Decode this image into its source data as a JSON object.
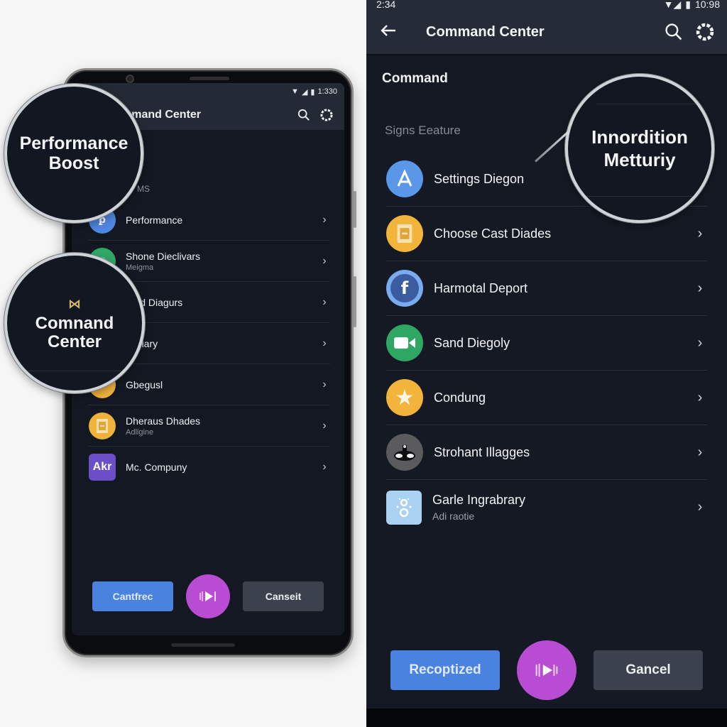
{
  "left_phone": {
    "status_bar": {
      "time": "1:330"
    },
    "app_bar": {
      "title": "mmand Center",
      "search_icon": "search-icon",
      "settings_icon": "gear-icon"
    },
    "section_label": "MS",
    "items": [
      {
        "title": "Performance",
        "subtitle": "",
        "icon": "performance-icon",
        "color": "#4f86e0"
      },
      {
        "title": "Shone Dieclivars",
        "subtitle": "Meigma",
        "icon": "gear-icon",
        "color": "#2fa866"
      },
      {
        "title": "rand Diagurs",
        "subtitle": "",
        "icon": "generic-icon",
        "color": "#3b4250"
      },
      {
        "title": "ntullary",
        "subtitle": "",
        "icon": "generic-icon",
        "color": "#3b4250"
      },
      {
        "title": "Gbegusl",
        "subtitle": "",
        "icon": "generic-icon",
        "color": "#f0b23b"
      },
      {
        "title": "Dherаus Dhades",
        "subtitle": "Adligine",
        "icon": "document-icon",
        "color": "#f0b23b"
      },
      {
        "title": "Mc. Compuny",
        "subtitle": "",
        "icon": "app-icon",
        "icon_text": "Akr",
        "color": "#6a4fc6"
      }
    ],
    "buttons": {
      "primary": "Cantfrec",
      "secondary": "Canseit"
    },
    "callouts": {
      "performance": [
        "Performance",
        "Boost"
      ],
      "command": [
        "Comnand",
        "Center"
      ]
    }
  },
  "right_panel": {
    "status_bar": {
      "time": "2:34",
      "battery": "10:98"
    },
    "app_bar": {
      "title": "Command Center",
      "back_icon": "back-arrow-icon",
      "search_icon": "search-icon",
      "settings_icon": "gear-icon"
    },
    "heading": "Command",
    "section_label": "Signs Eeature",
    "items": [
      {
        "title": "Settings Diegon",
        "subtitle": "",
        "icon": "app-store-icon",
        "color": "#5b97e8"
      },
      {
        "title": "Choose Cast Diades",
        "subtitle": "",
        "icon": "document-icon",
        "color": "#f2b43a"
      },
      {
        "title": "Harmotal Deport",
        "subtitle": "",
        "icon": "facebook-icon",
        "color": "#7aaaf0"
      },
      {
        "title": "Sand Diegoly",
        "subtitle": "",
        "icon": "video-camera-icon",
        "color": "#2ea763"
      },
      {
        "title": "Condung",
        "subtitle": "",
        "icon": "star-icon",
        "color": "#f2b43a"
      },
      {
        "title": "Strohant Illagges",
        "subtitle": "",
        "icon": "spy-icon",
        "color": "#5b5b5e"
      },
      {
        "title": "Garle Ingrabrary",
        "subtitle": "Adi raotie",
        "icon": "library-icon",
        "color": "#a9d1f2"
      }
    ],
    "buttons": {
      "primary": "Recoptized",
      "secondary": "Gancel"
    },
    "callout": [
      "Innordition",
      "Metturiy"
    ]
  },
  "colors": {
    "primary": "#4a82e0",
    "fab": "#b84dd4",
    "secondary": "#3b424d",
    "background": "#141923",
    "appbar": "#252c37"
  }
}
